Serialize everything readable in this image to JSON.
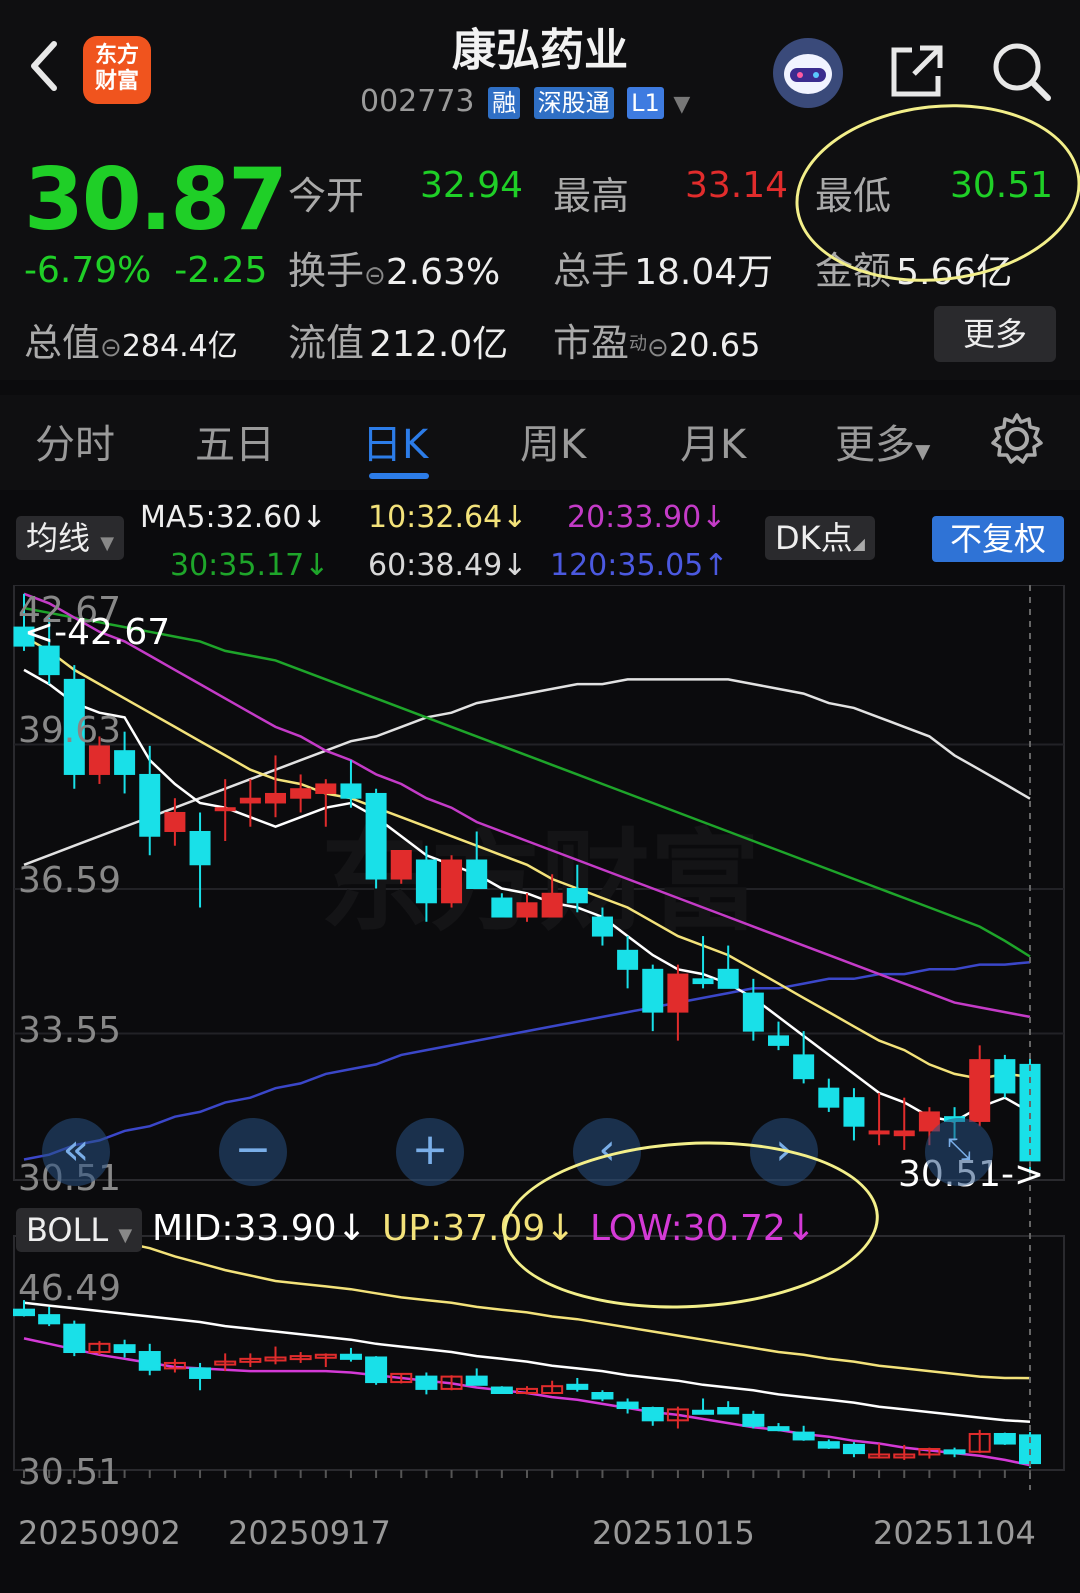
{
  "header": {
    "app_logo_line1": "东方",
    "app_logo_line2": "财富",
    "stock_name": "康弘药业",
    "stock_code": "002773",
    "tags": [
      "融",
      "深股通",
      "L1"
    ]
  },
  "quote": {
    "price": "30.87",
    "change_pct": "-6.79%",
    "change_amt": "-2.25",
    "open_label": "今开",
    "open": "32.94",
    "high_label": "最高",
    "high": "33.14",
    "low_label": "最低",
    "low": "30.51",
    "turnover_label": "换手",
    "turnover": "2.63%",
    "volume_label": "总手",
    "volume": "18.04万",
    "amount_label": "金额",
    "amount": "5.66亿",
    "mktcap_label": "总值",
    "mktcap": "284.4亿",
    "float_label": "流值",
    "float_cap": "212.0亿",
    "pe_label": "市盈",
    "pe_sup": "动",
    "pe": "20.65",
    "more": "更多"
  },
  "tabs": [
    "分时",
    "五日",
    "日K",
    "周K",
    "月K",
    "更多"
  ],
  "ma_bar": {
    "selector": "均线",
    "ma5": "MA5:32.60↓",
    "ma10": "10:32.64↓",
    "ma20": "20:33.90↓",
    "ma30": "30:35.17↓",
    "ma60": "60:38.49↓",
    "ma120": "120:35.05↑",
    "dk": "DK点",
    "adjust": "不复权"
  },
  "main_axis": [
    "42.67",
    "39.63",
    "36.59",
    "33.55",
    "30.51"
  ],
  "max_marker": "<-42.67",
  "min_marker": "30.51->",
  "boll_bar": {
    "selector": "BOLL",
    "mid": "MID:33.90↓",
    "up": "UP:37.09↓",
    "low": "LOW:30.72↓"
  },
  "boll_axis": [
    "46.49",
    "30.51"
  ],
  "dates": [
    "20250902",
    "20250917",
    "20251015",
    "20251104"
  ],
  "colors": {
    "up": "#e12c2c",
    "down": "#19e0e8",
    "accent": "#2c7ce8",
    "ma5": "#ffffff",
    "ma10": "#f3e27a",
    "ma20": "#c43bc7",
    "ma30": "#1ea52a",
    "ma60": "#e2e2e2",
    "ma120": "#3b47c9"
  },
  "chart_data": {
    "type": "candlestick",
    "candles": [
      {
        "o": 42.1,
        "h": 42.8,
        "l": 41.6,
        "c": 41.7
      },
      {
        "o": 41.7,
        "h": 42.3,
        "l": 40.9,
        "c": 41.1
      },
      {
        "o": 41.0,
        "h": 41.3,
        "l": 38.7,
        "c": 39.0
      },
      {
        "o": 39.0,
        "h": 39.8,
        "l": 38.8,
        "c": 39.6
      },
      {
        "o": 39.5,
        "h": 39.9,
        "l": 38.6,
        "c": 39.0
      },
      {
        "o": 39.0,
        "h": 39.6,
        "l": 37.3,
        "c": 37.7
      },
      {
        "o": 37.8,
        "h": 38.5,
        "l": 37.5,
        "c": 38.2
      },
      {
        "o": 37.8,
        "h": 38.2,
        "l": 36.2,
        "c": 37.1
      },
      {
        "o": 38.3,
        "h": 38.9,
        "l": 37.6,
        "c": 38.3
      },
      {
        "o": 38.4,
        "h": 38.9,
        "l": 37.9,
        "c": 38.5
      },
      {
        "o": 38.4,
        "h": 39.4,
        "l": 38.1,
        "c": 38.6
      },
      {
        "o": 38.5,
        "h": 39.0,
        "l": 38.2,
        "c": 38.7
      },
      {
        "o": 38.6,
        "h": 38.9,
        "l": 37.9,
        "c": 38.8
      },
      {
        "o": 38.8,
        "h": 39.3,
        "l": 38.3,
        "c": 38.5
      },
      {
        "o": 38.6,
        "h": 38.7,
        "l": 36.6,
        "c": 36.8
      },
      {
        "o": 36.8,
        "h": 37.4,
        "l": 36.7,
        "c": 37.4
      },
      {
        "o": 37.2,
        "h": 37.5,
        "l": 35.9,
        "c": 36.3
      },
      {
        "o": 36.3,
        "h": 37.3,
        "l": 36.2,
        "c": 37.2
      },
      {
        "o": 37.2,
        "h": 37.8,
        "l": 36.6,
        "c": 36.6
      },
      {
        "o": 36.4,
        "h": 36.5,
        "l": 36.0,
        "c": 36.0
      },
      {
        "o": 36.0,
        "h": 36.5,
        "l": 35.9,
        "c": 36.3
      },
      {
        "o": 36.0,
        "h": 36.9,
        "l": 36.0,
        "c": 36.5
      },
      {
        "o": 36.6,
        "h": 37.1,
        "l": 36.1,
        "c": 36.3
      },
      {
        "o": 36.0,
        "h": 36.2,
        "l": 35.4,
        "c": 35.6
      },
      {
        "o": 35.3,
        "h": 35.6,
        "l": 34.5,
        "c": 34.9
      },
      {
        "o": 34.9,
        "h": 35.0,
        "l": 33.6,
        "c": 34.0
      },
      {
        "o": 34.0,
        "h": 35.0,
        "l": 33.4,
        "c": 34.8
      },
      {
        "o": 34.7,
        "h": 35.6,
        "l": 34.5,
        "c": 34.6
      },
      {
        "o": 34.9,
        "h": 35.4,
        "l": 34.5,
        "c": 34.5
      },
      {
        "o": 34.4,
        "h": 34.7,
        "l": 33.4,
        "c": 33.6
      },
      {
        "o": 33.5,
        "h": 33.8,
        "l": 33.2,
        "c": 33.3
      },
      {
        "o": 33.1,
        "h": 33.6,
        "l": 32.5,
        "c": 32.6
      },
      {
        "o": 32.4,
        "h": 32.6,
        "l": 31.9,
        "c": 32.0
      },
      {
        "o": 32.2,
        "h": 32.4,
        "l": 31.3,
        "c": 31.6
      },
      {
        "o": 31.5,
        "h": 32.3,
        "l": 31.2,
        "c": 31.5
      },
      {
        "o": 31.4,
        "h": 32.2,
        "l": 31.1,
        "c": 31.5
      },
      {
        "o": 31.5,
        "h": 32.0,
        "l": 31.2,
        "c": 31.9
      },
      {
        "o": 31.8,
        "h": 32.0,
        "l": 31.3,
        "c": 31.7
      },
      {
        "o": 31.7,
        "h": 33.3,
        "l": 31.6,
        "c": 33.0
      },
      {
        "o": 33.0,
        "h": 33.1,
        "l": 32.2,
        "c": 32.3
      },
      {
        "o": 32.9,
        "h": 33.14,
        "l": 30.51,
        "c": 30.87
      }
    ],
    "ma5": [
      41.2,
      40.9,
      40.5,
      40.3,
      40.2,
      39.3,
      38.8,
      38.4,
      38.3,
      38.1,
      37.9,
      38.1,
      38.3,
      38.4,
      38.1,
      37.7,
      37.3,
      37.1,
      36.9,
      36.6,
      36.5,
      36.3,
      36.2,
      36.0,
      35.6,
      35.2,
      34.9,
      34.8,
      34.6,
      34.3,
      33.9,
      33.5,
      33.1,
      32.7,
      32.3,
      32.1,
      31.8,
      31.7,
      32.0,
      32.2,
      31.9
    ],
    "ma10": [
      41.9,
      41.6,
      41.2,
      40.9,
      40.6,
      40.3,
      40.0,
      39.7,
      39.4,
      39.1,
      38.9,
      38.8,
      38.6,
      38.5,
      38.3,
      38.1,
      37.9,
      37.7,
      37.5,
      37.3,
      37.1,
      36.8,
      36.6,
      36.4,
      36.2,
      35.9,
      35.6,
      35.4,
      35.2,
      34.9,
      34.6,
      34.3,
      34.0,
      33.7,
      33.4,
      33.2,
      32.9,
      32.7,
      32.6,
      32.7,
      32.64
    ],
    "ma20": [
      42.8,
      42.6,
      42.3,
      42.0,
      41.8,
      41.5,
      41.2,
      40.9,
      40.6,
      40.3,
      40.0,
      39.8,
      39.5,
      39.3,
      39.0,
      38.8,
      38.5,
      38.3,
      38.0,
      37.8,
      37.6,
      37.4,
      37.2,
      37.0,
      36.8,
      36.6,
      36.4,
      36.2,
      36.0,
      35.8,
      35.6,
      35.4,
      35.2,
      35.0,
      34.8,
      34.6,
      34.4,
      34.2,
      34.1,
      34.0,
      33.9
    ],
    "ma30": [
      42.5,
      42.4,
      42.3,
      42.2,
      42.1,
      42.0,
      41.9,
      41.8,
      41.6,
      41.5,
      41.4,
      41.2,
      41.0,
      40.8,
      40.6,
      40.4,
      40.2,
      40.0,
      39.8,
      39.6,
      39.4,
      39.2,
      39.0,
      38.8,
      38.6,
      38.4,
      38.2,
      38.0,
      37.8,
      37.6,
      37.4,
      37.2,
      37.0,
      36.8,
      36.6,
      36.4,
      36.2,
      36.0,
      35.8,
      35.5,
      35.17
    ],
    "ma60": [
      37.1,
      37.3,
      37.5,
      37.7,
      37.9,
      38.1,
      38.3,
      38.5,
      38.7,
      38.9,
      39.1,
      39.3,
      39.5,
      39.7,
      39.8,
      40.0,
      40.2,
      40.3,
      40.5,
      40.6,
      40.7,
      40.8,
      40.9,
      40.9,
      41.0,
      41.0,
      41.0,
      41.0,
      41.0,
      40.9,
      40.8,
      40.7,
      40.5,
      40.4,
      40.2,
      40.0,
      39.8,
      39.4,
      39.1,
      38.8,
      38.49
    ],
    "ma120": [
      30.9,
      31.0,
      31.2,
      31.3,
      31.5,
      31.6,
      31.8,
      31.9,
      32.1,
      32.2,
      32.4,
      32.5,
      32.7,
      32.8,
      32.9,
      33.1,
      33.2,
      33.3,
      33.4,
      33.5,
      33.6,
      33.7,
      33.8,
      33.9,
      34.0,
      34.1,
      34.2,
      34.3,
      34.4,
      34.5,
      34.5,
      34.6,
      34.7,
      34.7,
      34.8,
      34.8,
      34.9,
      34.9,
      35.0,
      35.0,
      35.05
    ],
    "boll_mid": [
      42.6,
      42.4,
      42.2,
      42.0,
      41.8,
      41.6,
      41.4,
      41.2,
      40.9,
      40.7,
      40.5,
      40.3,
      40.1,
      39.9,
      39.6,
      39.4,
      39.2,
      39.0,
      38.7,
      38.5,
      38.3,
      38.0,
      37.8,
      37.6,
      37.3,
      37.1,
      36.9,
      36.6,
      36.4,
      36.2,
      35.9,
      35.7,
      35.5,
      35.3,
      35.0,
      34.8,
      34.6,
      34.4,
      34.2,
      34.0,
      33.9
    ],
    "boll_up": [
      47.0,
      47.1,
      47.2,
      47.1,
      47.0,
      46.6,
      46.0,
      45.5,
      45.0,
      44.6,
      44.2,
      44.0,
      43.8,
      43.6,
      43.3,
      43.0,
      42.8,
      42.6,
      42.3,
      42.1,
      41.9,
      41.6,
      41.4,
      41.1,
      40.8,
      40.5,
      40.2,
      39.9,
      39.6,
      39.3,
      39.0,
      38.8,
      38.5,
      38.3,
      38.0,
      37.8,
      37.6,
      37.4,
      37.2,
      37.1,
      37.09
    ],
    "boll_low": [
      40.0,
      39.6,
      39.2,
      38.8,
      38.5,
      38.2,
      37.9,
      37.8,
      37.7,
      37.6,
      37.6,
      37.6,
      37.6,
      37.5,
      37.3,
      37.1,
      36.9,
      36.7,
      36.4,
      36.2,
      36.0,
      35.7,
      35.5,
      35.2,
      34.9,
      34.6,
      34.4,
      34.1,
      33.8,
      33.5,
      33.3,
      33.0,
      32.8,
      32.5,
      32.3,
      32.0,
      31.8,
      31.6,
      31.4,
      31.1,
      30.72
    ]
  }
}
